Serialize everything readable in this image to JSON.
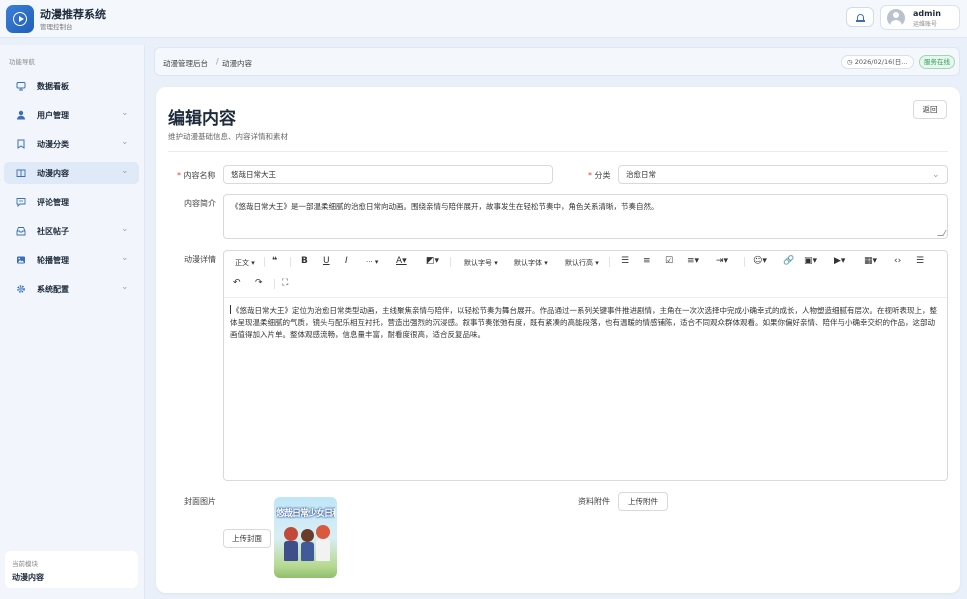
{
  "app": {
    "title": "动漫推荐系统",
    "subtitle": "管理控制台"
  },
  "header": {
    "user_name": "admin",
    "user_role": "运维账号"
  },
  "sidebar": {
    "heading": "功能导航",
    "items": [
      {
        "label": "数据看板",
        "icon": "dashboard-icon",
        "expandable": false
      },
      {
        "label": "用户管理",
        "icon": "user-icon",
        "expandable": true
      },
      {
        "label": "动漫分类",
        "icon": "bookmark-icon",
        "expandable": true
      },
      {
        "label": "动漫内容",
        "icon": "book-icon",
        "expandable": true,
        "active": true
      },
      {
        "label": "评论管理",
        "icon": "comment-icon",
        "expandable": false
      },
      {
        "label": "社区帖子",
        "icon": "inbox-icon",
        "expandable": true
      },
      {
        "label": "轮播管理",
        "icon": "image-icon",
        "expandable": true
      },
      {
        "label": "系统配置",
        "icon": "gear-icon",
        "expandable": true
      }
    ],
    "current_module_label": "当前模块",
    "current_module_value": "动漫内容"
  },
  "breadcrumb": {
    "items": [
      "动漫管理后台",
      "动漫内容"
    ],
    "separator": "/"
  },
  "status": {
    "date": "2026/02/16(日...",
    "state": "服务在线",
    "state_color": "#2e9a58"
  },
  "form": {
    "title": "编辑内容",
    "subtitle": "维护动漫基础信息、内容详情和素材",
    "back_label": "返回",
    "name_label": "内容名称",
    "name_value": "悠哉日常大王",
    "category_label": "分类",
    "category_value": "治愈日常",
    "summary_label": "内容简介",
    "summary_value": "《悠哉日常大王》是一部温柔细腻的治愈日常向动画。围绕亲情与陪伴展开，故事发生在轻松节奏中，角色关系清晰，节奏自然。",
    "detail_label": "动漫详情",
    "detail_value": "《悠哉日常大王》定位为治愈日常类型动画，主线聚焦亲情与陪伴，以轻松节奏为舞台展开。作品通过一系列关键事件推进剧情，主角在一次次选择中完成小确幸式的成长，人物塑造细腻有层次。在视听表现上，整体呈现温柔细腻的气质，镜头与配乐相互衬托，营造出强烈的沉浸感。叙事节奏张弛有度，既有紧凑的高能段落，也有温暖的情感铺陈，适合不同观众群体观看。如果你偏好亲情、陪伴与小确幸交织的作品，这部动画值得加入片单。整体观感流畅，信息量丰富，耐看度很高，适合反复品味。",
    "cover_label": "封面图片",
    "upload_cover_label": "上传封面",
    "cover_image_text": "悠哉日常少女日和",
    "attachment_label": "资料附件",
    "upload_attachment_label": "上传附件"
  },
  "toolbar": {
    "paragraph": "正文",
    "font_size": "默认字号",
    "font_family": "默认字体",
    "line_height": "默认行高",
    "more": "···"
  },
  "colors": {
    "accent": "#2f6fca",
    "background": "#e9f0f9",
    "required": "#e53e3e"
  }
}
